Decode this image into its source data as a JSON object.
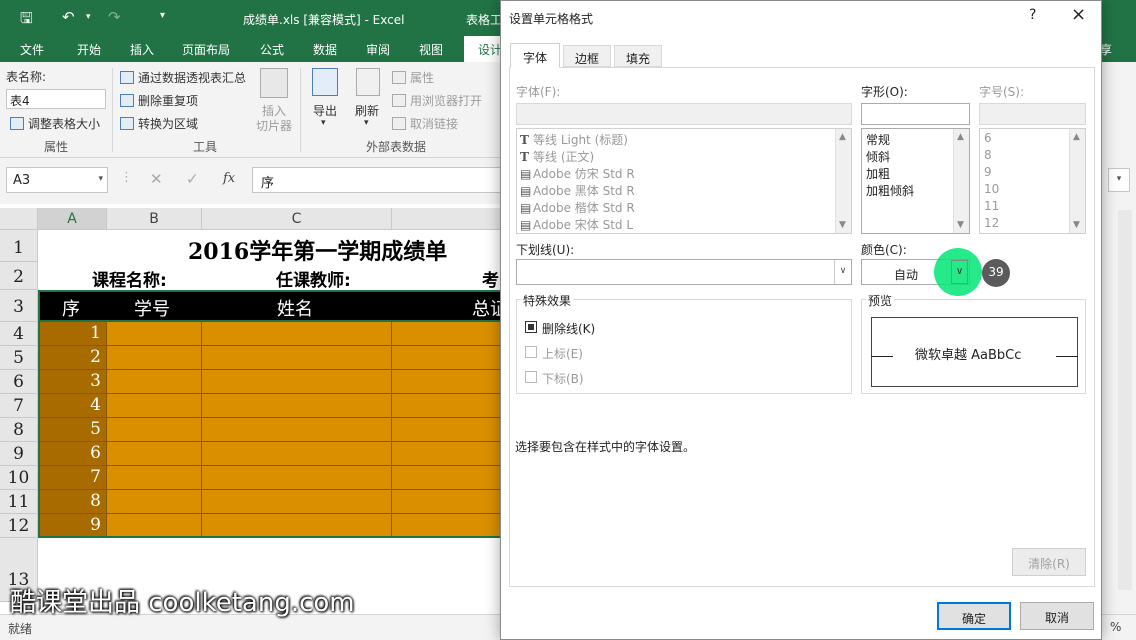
{
  "excel": {
    "window_title": "成绩单.xls  [兼容模式] - Excel",
    "contextual_tab": "表格工",
    "tabs": [
      "文件",
      "开始",
      "插入",
      "页面布局",
      "公式",
      "数据",
      "审阅",
      "视图",
      "设计"
    ],
    "share_partial": "享",
    "ribbon": {
      "table_name_label": "表名称:",
      "table_name_value": "表4",
      "resize_table": "调整表格大小",
      "group_properties": "属性",
      "pivot_summary": "通过数据透视表汇总",
      "remove_duplicates": "删除重复项",
      "convert_to_range": "转换为区域",
      "insert_slicer_line1": "插入",
      "insert_slicer_line2": "切片器",
      "group_tools": "工具",
      "export": "导出",
      "refresh": "刷新",
      "properties": "属性",
      "open_in_browser": "用浏览器打开",
      "unlink": "取消链接",
      "group_external": "外部表数据"
    },
    "name_box": "A3",
    "formula_value": "序",
    "fx": "fx",
    "columns": [
      "A",
      "B",
      "C"
    ],
    "rows": [
      "1",
      "2",
      "3",
      "4",
      "5",
      "6",
      "7",
      "8",
      "9",
      "10",
      "11",
      "12",
      "13"
    ],
    "sheet_title": "2016学年第一学期成绩单",
    "course_label": "课程名称:",
    "teacher_label": "任课教师:",
    "exam_partial": "考",
    "header_cells": [
      "序",
      "学号",
      "姓名",
      "总证"
    ],
    "seq_numbers": [
      "1",
      "2",
      "3",
      "4",
      "5",
      "6",
      "7",
      "8",
      "9"
    ],
    "status_ready": "就绪",
    "zoom_partial": "%"
  },
  "dialog": {
    "title": "设置单元格格式",
    "help": "?",
    "close": "×",
    "tabs": [
      "字体",
      "边框",
      "填充"
    ],
    "font_label": "字体(F):",
    "style_label": "字形(O):",
    "size_label": "字号(S):",
    "font_list": [
      "等线 Light (标题)",
      "等线 (正文)",
      "Adobe 仿宋 Std R",
      "Adobe 黑体 Std R",
      "Adobe 楷体 Std R",
      "Adobe 宋体 Std L"
    ],
    "style_list": [
      "常规",
      "倾斜",
      "加粗",
      "加粗倾斜"
    ],
    "size_list": [
      "6",
      "8",
      "9",
      "10",
      "11",
      "12"
    ],
    "underline_label": "下划线(U):",
    "color_label": "颜色(C):",
    "color_value": "自动",
    "step_badge": "39",
    "effects_label": "特殊效果",
    "strikethrough": "删除线(K)",
    "superscript": "上标(E)",
    "subscript": "下标(B)",
    "preview_label": "预览",
    "preview_text": "微软卓越  AaBbCc",
    "hint": "选择要包含在样式中的字体设置。",
    "clear": "清除(R)",
    "ok": "确定",
    "cancel": "取消"
  },
  "watermark": "酷课堂出品 coolketang.com",
  "colors": {
    "excel_green": "#217346",
    "table_orange": "#d98f00",
    "seq_column": "#a86b00",
    "header_black": "#000000",
    "highlight_green": "#00e676",
    "badge_gray": "#5b5b5b"
  }
}
